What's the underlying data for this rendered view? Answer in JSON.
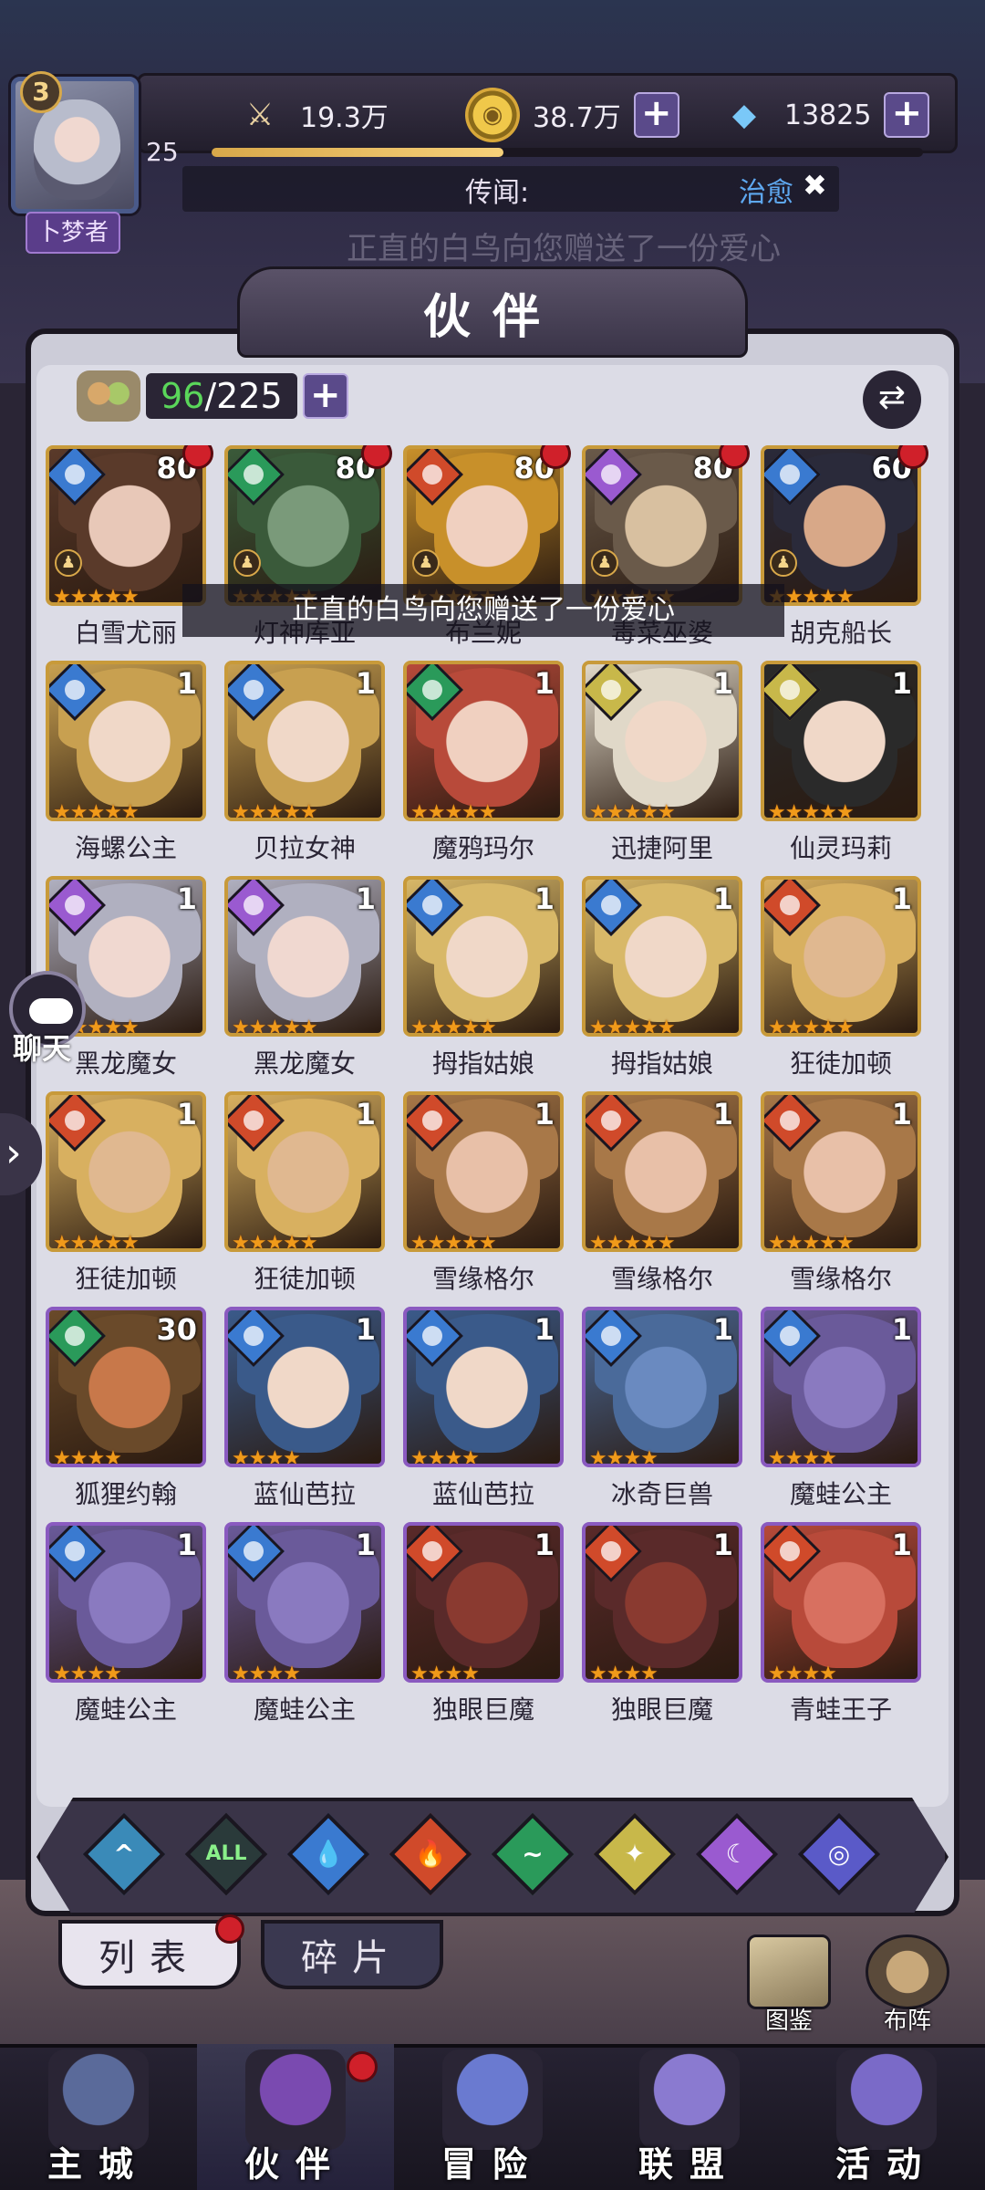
{
  "player": {
    "level_badge": "3",
    "title": "卜梦者",
    "level": "25",
    "xp_fraction": 0.41
  },
  "resources": {
    "power": "19.3万",
    "gold": "38.7万",
    "gems": "13825"
  },
  "rumor": {
    "label": "传闻:",
    "tag": "治愈",
    "faded_message": "正直的白鸟向您赠送了一份爱心"
  },
  "page": {
    "title": "伙伴"
  },
  "roster": {
    "current": "96",
    "max": "/225"
  },
  "toast": "正直的白鸟向您赠送了一份爱心",
  "heroes": [
    {
      "name": "白雪尤丽",
      "level": "80",
      "element": "water",
      "stars": 5,
      "frame": "gold",
      "dot": true,
      "chess": true
    },
    {
      "name": "灯神库亚",
      "level": "80",
      "element": "wind",
      "stars": 5,
      "frame": "gold",
      "dot": true,
      "chess": true
    },
    {
      "name": "布兰妮",
      "level": "80",
      "element": "fire",
      "stars": 5,
      "frame": "gold",
      "dot": true,
      "chess": true
    },
    {
      "name": "毒菜巫婆",
      "level": "80",
      "element": "dark",
      "stars": 5,
      "frame": "gold",
      "dot": true,
      "chess": true
    },
    {
      "name": "胡克船长",
      "level": "60",
      "element": "water",
      "stars": 5,
      "frame": "gold",
      "dot": true,
      "chess": true
    },
    {
      "name": "海螺公主",
      "level": "1",
      "element": "water",
      "stars": 5,
      "frame": "gold",
      "dot": false,
      "chess": false
    },
    {
      "name": "贝拉女神",
      "level": "1",
      "element": "water",
      "stars": 5,
      "frame": "gold",
      "dot": false,
      "chess": false
    },
    {
      "name": "魔鸦玛尔",
      "level": "1",
      "element": "wind",
      "stars": 5,
      "frame": "gold",
      "dot": false,
      "chess": false
    },
    {
      "name": "迅捷阿里",
      "level": "1",
      "element": "light",
      "stars": 5,
      "frame": "gold",
      "dot": false,
      "chess": false
    },
    {
      "name": "仙灵玛莉",
      "level": "1",
      "element": "light",
      "stars": 5,
      "frame": "gold",
      "dot": false,
      "chess": false
    },
    {
      "name": "黑龙魔女",
      "level": "1",
      "element": "dark",
      "stars": 5,
      "frame": "gold",
      "dot": false,
      "chess": false
    },
    {
      "name": "黑龙魔女",
      "level": "1",
      "element": "dark",
      "stars": 5,
      "frame": "gold",
      "dot": false,
      "chess": false
    },
    {
      "name": "拇指姑娘",
      "level": "1",
      "element": "water",
      "stars": 5,
      "frame": "gold",
      "dot": false,
      "chess": false
    },
    {
      "name": "拇指姑娘",
      "level": "1",
      "element": "water",
      "stars": 5,
      "frame": "gold",
      "dot": false,
      "chess": false
    },
    {
      "name": "狂徒加顿",
      "level": "1",
      "element": "fire",
      "stars": 5,
      "frame": "gold",
      "dot": false,
      "chess": false
    },
    {
      "name": "狂徒加顿",
      "level": "1",
      "element": "fire",
      "stars": 5,
      "frame": "gold",
      "dot": false,
      "chess": false
    },
    {
      "name": "狂徒加顿",
      "level": "1",
      "element": "fire",
      "stars": 5,
      "frame": "gold",
      "dot": false,
      "chess": false
    },
    {
      "name": "雪缘格尔",
      "level": "1",
      "element": "fire",
      "stars": 5,
      "frame": "gold",
      "dot": false,
      "chess": false
    },
    {
      "name": "雪缘格尔",
      "level": "1",
      "element": "fire",
      "stars": 5,
      "frame": "gold",
      "dot": false,
      "chess": false
    },
    {
      "name": "雪缘格尔",
      "level": "1",
      "element": "fire",
      "stars": 5,
      "frame": "gold",
      "dot": false,
      "chess": false
    },
    {
      "name": "狐狸约翰",
      "level": "30",
      "element": "wind",
      "stars": 4,
      "frame": "purple",
      "dot": false,
      "chess": false
    },
    {
      "name": "蓝仙芭拉",
      "level": "1",
      "element": "water",
      "stars": 4,
      "frame": "purple",
      "dot": false,
      "chess": false
    },
    {
      "name": "蓝仙芭拉",
      "level": "1",
      "element": "water",
      "stars": 4,
      "frame": "purple",
      "dot": false,
      "chess": false
    },
    {
      "name": "冰奇巨兽",
      "level": "1",
      "element": "water",
      "stars": 4,
      "frame": "purple",
      "dot": false,
      "chess": false
    },
    {
      "name": "魔蛙公主",
      "level": "1",
      "element": "water",
      "stars": 4,
      "frame": "purple",
      "dot": false,
      "chess": false
    },
    {
      "name": "魔蛙公主",
      "level": "1",
      "element": "water",
      "stars": 4,
      "frame": "purple",
      "dot": false,
      "chess": false
    },
    {
      "name": "魔蛙公主",
      "level": "1",
      "element": "water",
      "stars": 4,
      "frame": "purple",
      "dot": false,
      "chess": false
    },
    {
      "name": "独眼巨魔",
      "level": "1",
      "element": "fire",
      "stars": 4,
      "frame": "purple",
      "dot": false,
      "chess": false
    },
    {
      "name": "独眼巨魔",
      "level": "1",
      "element": "fire",
      "stars": 4,
      "frame": "purple",
      "dot": false,
      "chess": false
    },
    {
      "name": "青蛙王子",
      "level": "1",
      "element": "fire",
      "stars": 4,
      "frame": "purple",
      "dot": false,
      "chess": false
    }
  ],
  "element_colors": {
    "water": "#3a7ad0",
    "wind": "#2a9a5a",
    "fire": "#d04a2a",
    "dark": "#9a5ad0",
    "light": "#c8b84a"
  },
  "filters": [
    {
      "id": "faction",
      "glyph": "^",
      "color": "#3a8ab8"
    },
    {
      "id": "all",
      "glyph": "ALL",
      "color": "#2a3a3a"
    },
    {
      "id": "water",
      "glyph": "💧",
      "color": "#3a7ad0"
    },
    {
      "id": "fire",
      "glyph": "🔥",
      "color": "#d04a2a"
    },
    {
      "id": "wind",
      "glyph": "~",
      "color": "#2a9a5a"
    },
    {
      "id": "light",
      "glyph": "✦",
      "color": "#c8b84a"
    },
    {
      "id": "dark",
      "glyph": "☾",
      "color": "#9a5ad0"
    },
    {
      "id": "cosmic",
      "glyph": "◎",
      "color": "#5a5ac8"
    }
  ],
  "tabs": {
    "list": "列表",
    "shards": "碎片"
  },
  "side_buttons": {
    "codex": "图鉴",
    "formation": "布阵"
  },
  "chat": {
    "label": "聊天"
  },
  "nav": [
    {
      "label": "主城",
      "color": "#5a6a9a"
    },
    {
      "label": "伙伴",
      "color": "#7a4ab0"
    },
    {
      "label": "冒险",
      "color": "#6a7ad0"
    },
    {
      "label": "联盟",
      "color": "#8a7ad0"
    },
    {
      "label": "活动",
      "color": "#7a6ac8"
    }
  ]
}
